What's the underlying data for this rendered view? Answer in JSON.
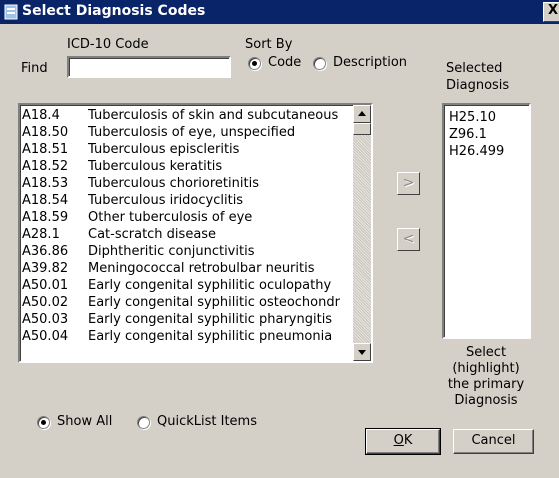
{
  "window": {
    "title": "Select Diagnosis Codes",
    "close_glyph": "X"
  },
  "find": {
    "label": "Find",
    "code_label": "ICD-10 Code",
    "value": ""
  },
  "sort": {
    "label": "Sort By",
    "options": [
      {
        "label": "Code",
        "checked": true
      },
      {
        "label": "Description",
        "checked": false
      }
    ]
  },
  "selected": {
    "label_line1": "Selected",
    "label_line2": "Diagnosis",
    "items": [
      "H25.10",
      "Z96.1",
      "H26.499"
    ]
  },
  "codes": [
    {
      "code": "A18.4",
      "desc": "Tuberculosis of skin and subcutaneous"
    },
    {
      "code": "A18.50",
      "desc": "Tuberculosis of eye, unspecified"
    },
    {
      "code": "A18.51",
      "desc": "Tuberculous episcleritis"
    },
    {
      "code": "A18.52",
      "desc": "Tuberculous keratitis"
    },
    {
      "code": "A18.53",
      "desc": "Tuberculous chorioretinitis"
    },
    {
      "code": "A18.54",
      "desc": "Tuberculous iridocyclitis"
    },
    {
      "code": "A18.59",
      "desc": "Other tuberculosis of eye"
    },
    {
      "code": "A28.1",
      "desc": "Cat-scratch disease"
    },
    {
      "code": "A36.86",
      "desc": "Diphtheritic conjunctivitis"
    },
    {
      "code": "A39.82",
      "desc": "Meningococcal retrobulbar neuritis"
    },
    {
      "code": "A50.01",
      "desc": "Early congenital syphilitic oculopathy"
    },
    {
      "code": "A50.02",
      "desc": "Early congenital syphilitic osteochondr"
    },
    {
      "code": "A50.03",
      "desc": "Early congenital syphilitic pharyngitis"
    },
    {
      "code": "A50.04",
      "desc": "Early congenital syphilitic pneumonia"
    }
  ],
  "move": {
    "add": ">",
    "remove": "<"
  },
  "hint": {
    "line1": "Select",
    "line2": "(highlight)",
    "line3": "the primary",
    "line4": "Diagnosis"
  },
  "filter": {
    "options": [
      {
        "label": "Show All",
        "checked": true
      },
      {
        "label": "QuickList Items",
        "checked": false
      }
    ]
  },
  "buttons": {
    "ok_mnemonic": "O",
    "ok_rest": "K",
    "cancel": "Cancel"
  },
  "colors": {
    "title_bar": "#0a246a",
    "face": "#d4d0c8"
  },
  "icons": {
    "title": "window-icon",
    "close": "close-icon"
  }
}
